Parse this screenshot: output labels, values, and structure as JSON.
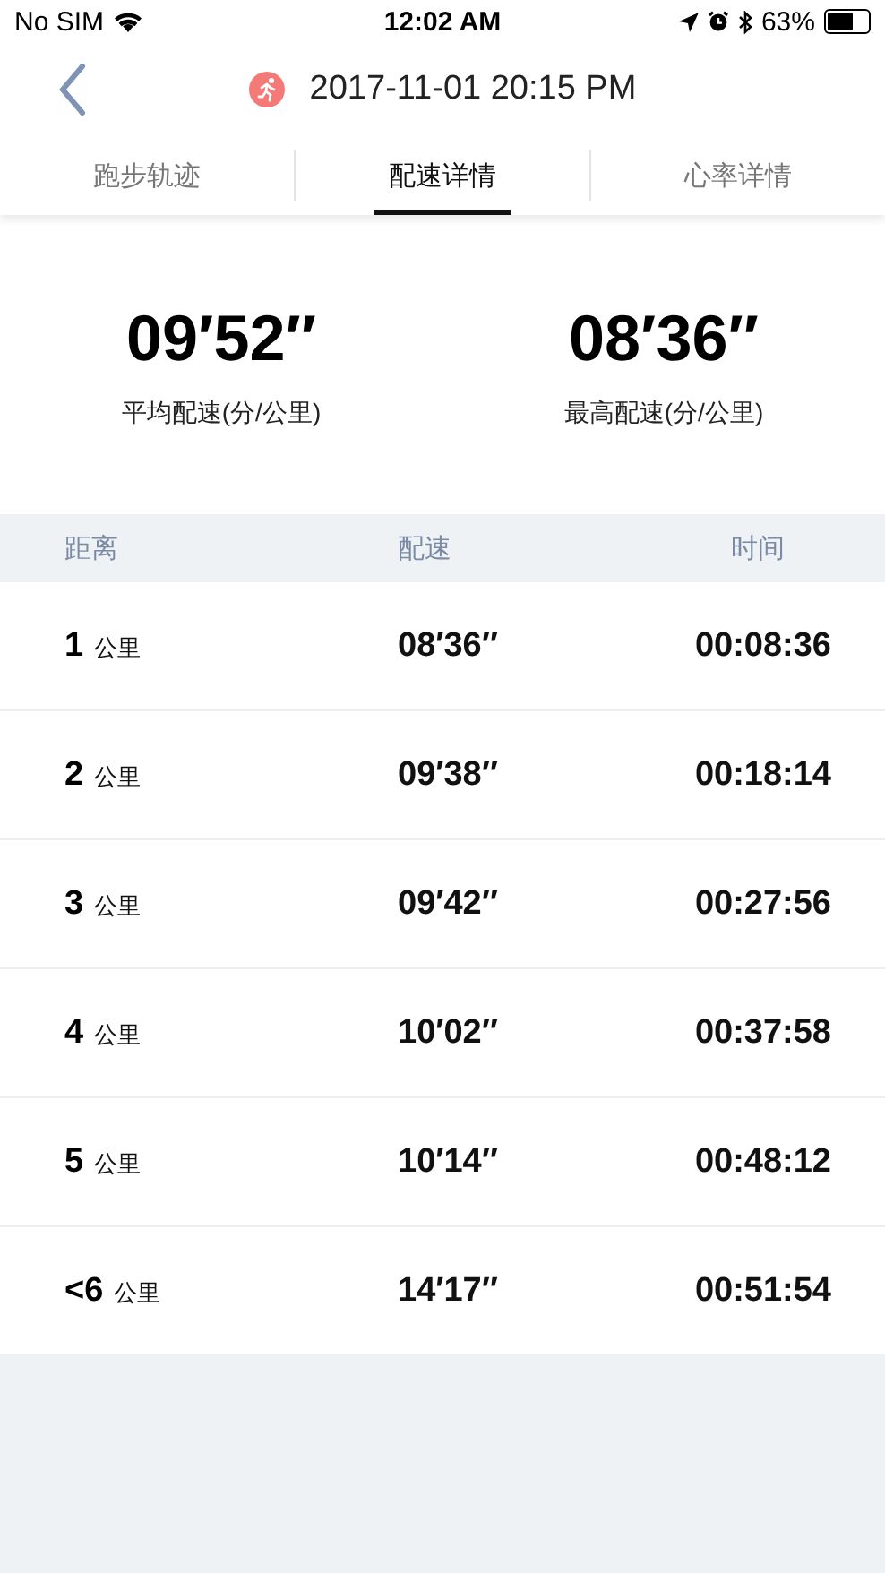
{
  "status_bar": {
    "carrier": "No SIM",
    "time": "12:02 AM",
    "battery": "63%"
  },
  "header": {
    "title": "2017-11-01 20:15 PM"
  },
  "tabs": [
    {
      "label": "跑步轨迹",
      "selected": false
    },
    {
      "label": "配速详情",
      "selected": true
    },
    {
      "label": "心率详情",
      "selected": false
    }
  ],
  "summary": [
    {
      "value": "09′52″",
      "label": "平均配速(分/公里)"
    },
    {
      "value": "08′36″",
      "label": "最高配速(分/公里)"
    }
  ],
  "table": {
    "columns": [
      "距离",
      "配速",
      "时间"
    ],
    "rows": [
      {
        "distance": "1",
        "unit": "公里",
        "pace": "08′36″",
        "time": "00:08:36"
      },
      {
        "distance": "2",
        "unit": "公里",
        "pace": "09′38″",
        "time": "00:18:14"
      },
      {
        "distance": "3",
        "unit": "公里",
        "pace": "09′42″",
        "time": "00:27:56"
      },
      {
        "distance": "4",
        "unit": "公里",
        "pace": "10′02″",
        "time": "00:37:58"
      },
      {
        "distance": "5",
        "unit": "公里",
        "pace": "10′14″",
        "time": "00:48:12"
      },
      {
        "distance": "<6",
        "unit": "公里",
        "pace": "14′17″",
        "time": "00:51:54"
      }
    ]
  }
}
